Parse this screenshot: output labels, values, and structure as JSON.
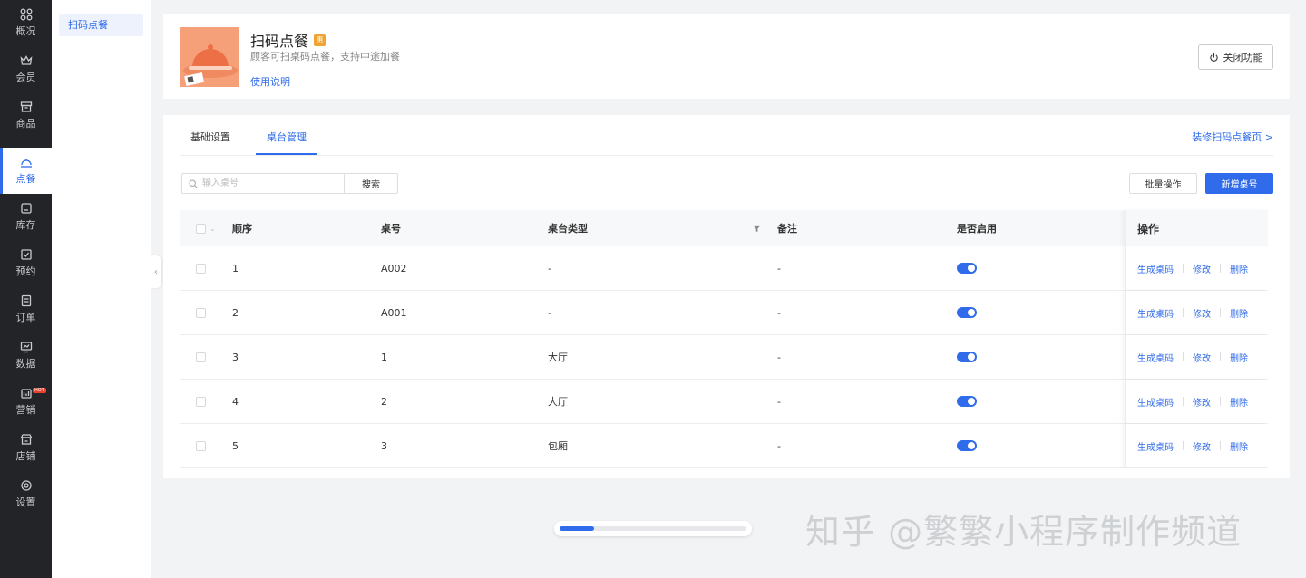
{
  "nav": {
    "items": [
      {
        "label": "概况",
        "icon": "dashboard-icon"
      },
      {
        "label": "会员",
        "icon": "crown-icon"
      },
      {
        "label": "商品",
        "icon": "shop-box-icon"
      },
      {
        "label": "点餐",
        "icon": "dish-cover-icon",
        "active": true
      },
      {
        "label": "库存",
        "icon": "warehouse-icon"
      },
      {
        "label": "预约",
        "icon": "calendar-check-icon"
      },
      {
        "label": "订单",
        "icon": "order-list-icon"
      },
      {
        "label": "数据",
        "icon": "chart-monitor-icon"
      },
      {
        "label": "营销",
        "icon": "marketing-icon",
        "badge": "HOT"
      },
      {
        "label": "店铺",
        "icon": "store-icon"
      },
      {
        "label": "设置",
        "icon": "settings-icon"
      }
    ]
  },
  "subnav": {
    "items": [
      {
        "label": "扫码点餐",
        "active": true
      }
    ]
  },
  "header": {
    "title": "扫码点餐",
    "badge": "惠",
    "description": "顾客可扫桌码点餐，支持中途加餐",
    "help_link": "使用说明",
    "close_button": "关闭功能"
  },
  "tabs": [
    {
      "label": "基础设置",
      "active": false
    },
    {
      "label": "桌台管理",
      "active": true
    }
  ],
  "decorate_link": "装修扫码点餐页 >",
  "search": {
    "placeholder": "输入桌号",
    "value": "",
    "button": "搜索"
  },
  "toolbar": {
    "batch": "批量操作",
    "add": "新增桌号"
  },
  "table": {
    "columns": {
      "order": "顺序",
      "table_no": "桌号",
      "table_type": "桌台类型",
      "remark": "备注",
      "enabled": "是否启用",
      "actions": "操作"
    },
    "rows": [
      {
        "order": "1",
        "table_no": "A002",
        "table_type": "-",
        "remark": "-",
        "enabled": true
      },
      {
        "order": "2",
        "table_no": "A001",
        "table_type": "-",
        "remark": "-",
        "enabled": true
      },
      {
        "order": "3",
        "table_no": "1",
        "table_type": "大厅",
        "remark": "-",
        "enabled": true
      },
      {
        "order": "4",
        "table_no": "2",
        "table_type": "大厅",
        "remark": "-",
        "enabled": true
      },
      {
        "order": "5",
        "table_no": "3",
        "table_type": "包厢",
        "remark": "-",
        "enabled": true
      }
    ],
    "actions": {
      "gen_code": "生成桌码",
      "edit": "修改",
      "delete": "删除"
    }
  },
  "scrollbar": {
    "position": 0.18
  },
  "watermark": "知乎 @繁繁小程序制作频道",
  "colors": {
    "primary": "#2f6bea",
    "nav_bg": "#222428",
    "hot_badge": "#e8422f",
    "badge": "#f0a232"
  }
}
